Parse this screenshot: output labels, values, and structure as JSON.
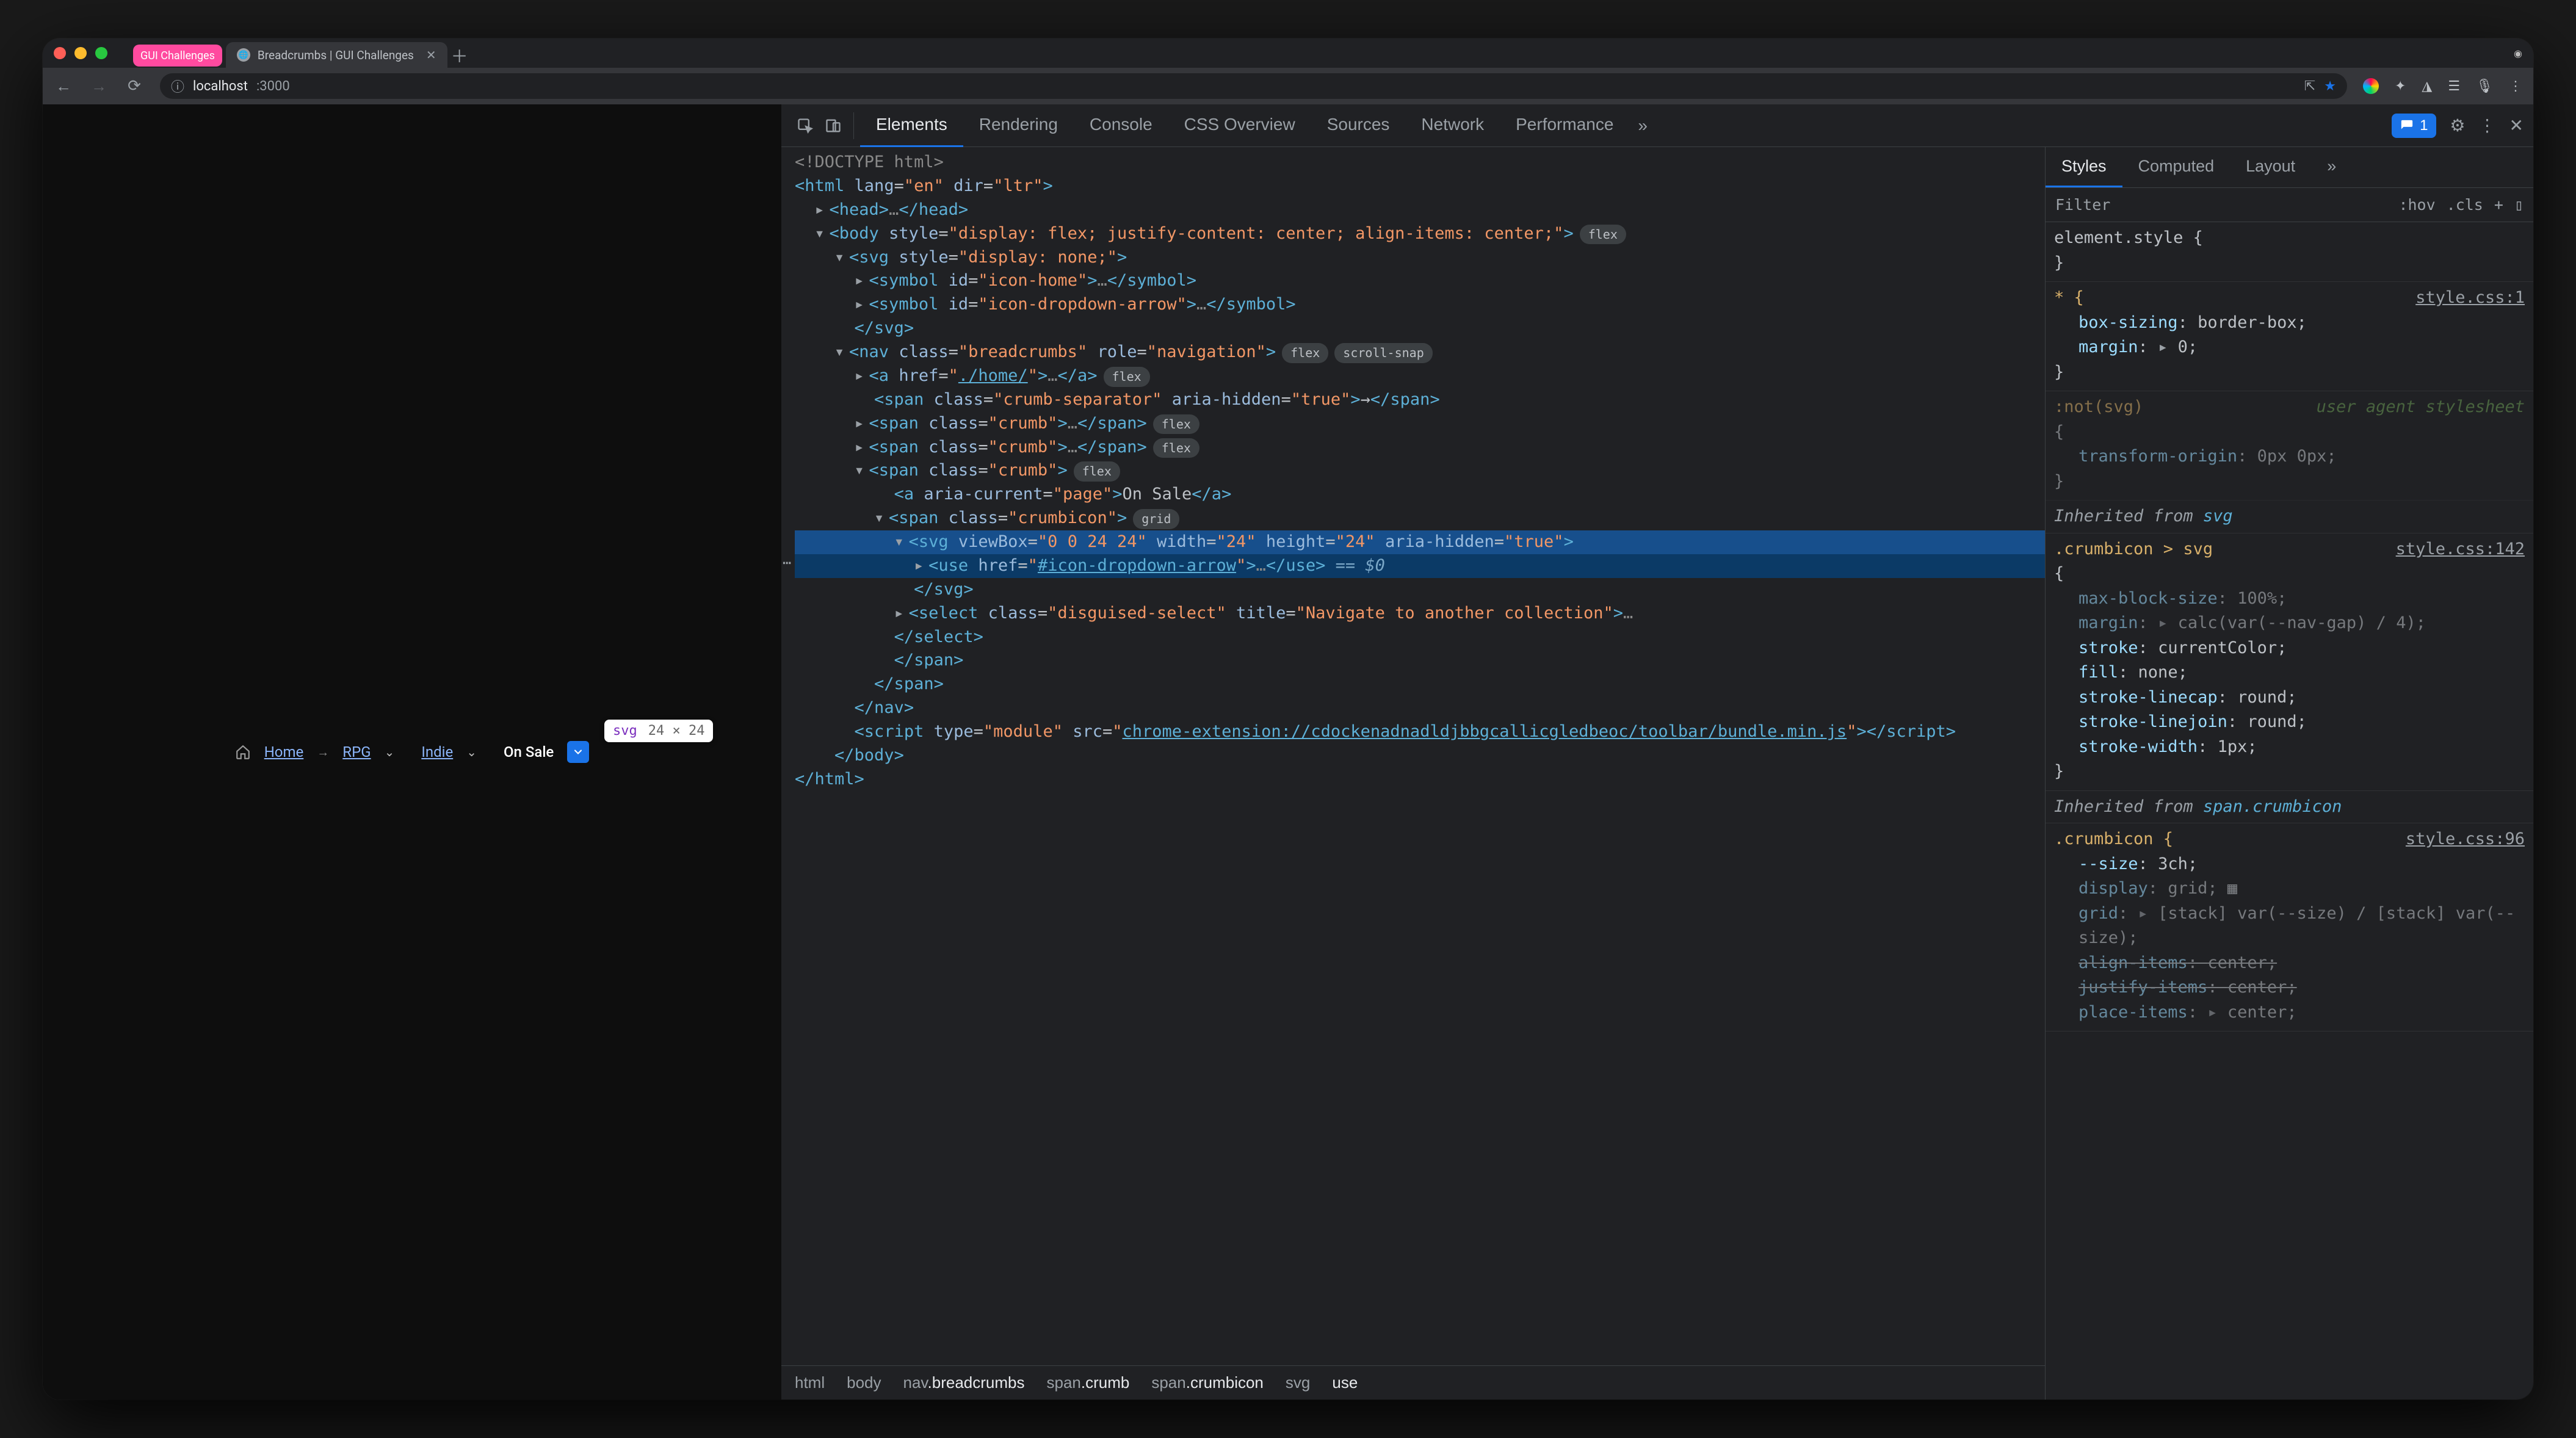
{
  "browser_tabs": {
    "pink_label": "GUI Challenges",
    "active": {
      "label": "Breadcrumbs | GUI Challenges",
      "favicon": "globe"
    }
  },
  "address_bar": {
    "host": "localhost",
    "port": ":3000"
  },
  "page": {
    "crumbs": {
      "home": "Home",
      "rpg": "RPG",
      "indie": "Indie",
      "sale": "On Sale"
    },
    "tooltip": {
      "tag": "svg",
      "dim": "24 × 24"
    }
  },
  "devtools": {
    "tabs": [
      "Elements",
      "Rendering",
      "Console",
      "CSS Overview",
      "Sources",
      "Network",
      "Performance"
    ],
    "issues_count": "1",
    "dom": {
      "doctype": "<!DOCTYPE html>",
      "html_open": "<html lang=\"en\" dir=\"ltr\">",
      "head": "<head>…</head>",
      "body_open": "<body style=\"display: flex; justify-content: center; align-items: center;\">",
      "body_badge": "flex",
      "svg_open": "<svg style=\"display: none;\">",
      "sym_home": "<symbol id=\"icon-home\">…</symbol>",
      "sym_drop": "<symbol id=\"icon-dropdown-arrow\">…</symbol>",
      "svg_close": "</svg>",
      "nav_open": "<nav class=\"breadcrumbs\" role=\"navigation\">",
      "nav_badges": [
        "flex",
        "scroll-snap"
      ],
      "a_home": "<a href=\"./home/\">…</a>",
      "a_home_badge": "flex",
      "sep": "<span class=\"crumb-separator\" aria-hidden=\"true\">→</span>",
      "crumb1": "<span class=\"crumb\">…</span>",
      "crumb_badge": "flex",
      "crumb2": "<span class=\"crumb\">…</span>",
      "crumb3_open": "<span class=\"crumb\">",
      "a_sale": "<a aria-current=\"page\">On Sale</a>",
      "crumbicon_open": "<span class=\"crumbicon\">",
      "crumbicon_badge": "grid",
      "svg_sel": "<svg viewBox=\"0 0 24 24\" width=\"24\" height=\"24\" aria-hidden=\"true\">",
      "use_line": "<use href=\"#icon-dropdown-arrow\">…</use>",
      "dollar": " == $0",
      "svg_sel_close": "</svg>",
      "select_open": "<select class=\"disguised-select\" title=\"Navigate to another collection\">…",
      "select_close": "</select>",
      "span_close": "</span>",
      "nav_close": "</nav>",
      "script_line_a": "<script type=\"module\" src=\"",
      "script_url": "chrome-extension://cdockenadnadldjbbgcallicgledbeoc/toolbar/bundle.min.js",
      "script_line_b": "\"></scr",
      "script_line_c": "ipt>",
      "body_close": "</body>",
      "html_close": "</html>"
    },
    "breadcrumb_trail": [
      "html",
      "body",
      "nav.breadcrumbs",
      "span.crumb",
      "span.crumbicon",
      "svg",
      "use"
    ],
    "styles_tabs": [
      "Styles",
      "Computed",
      "Layout"
    ],
    "filter_label": "Filter",
    "filter_pills": [
      ":hov",
      ".cls",
      "+"
    ],
    "rules": {
      "r0": {
        "selector": "element.style {",
        "close": "}"
      },
      "r1": {
        "selector": "* {",
        "src": "style.css:1",
        "p1": "box-sizing",
        "v1": "border-box;",
        "p2": "margin",
        "v2": "0;",
        "close": "}"
      },
      "r2": {
        "selector": ":not(svg)",
        "comment": "user agent stylesheet",
        "open": "{",
        "p1": "transform-origin",
        "v1": "0px 0px;",
        "close": "}"
      },
      "inh1": "Inherited from ",
      "inh1tag": "svg",
      "r3": {
        "selector": ".crumbicon > svg",
        "src": "style.css:142",
        "open": "{",
        "p1": "max-block-size",
        "v1": "100%;",
        "p2": "margin",
        "v2": "calc(var(--nav-gap) / 4);",
        "p3": "stroke",
        "v3": "currentColor;",
        "p4": "fill",
        "v4": "none;",
        "p5": "stroke-linecap",
        "v5": "round;",
        "p6": "stroke-linejoin",
        "v6": "round;",
        "p7": "stroke-width",
        "v7": "1px;",
        "close": "}"
      },
      "inh2": "Inherited from ",
      "inh2tag": "span.crumbicon",
      "r4": {
        "selector": ".crumbicon {",
        "src": "style.css:96",
        "p1": "--size",
        "v1": "3ch;",
        "p2": "display",
        "v2": "grid;",
        "p3": "grid",
        "v3": "[stack] var(--size) / [stack] var(--size);",
        "p4": "align-items",
        "v4": "center;",
        "p5": "justify-items",
        "v5": "center;",
        "p6": "place-items",
        "v6": "center;"
      }
    }
  }
}
